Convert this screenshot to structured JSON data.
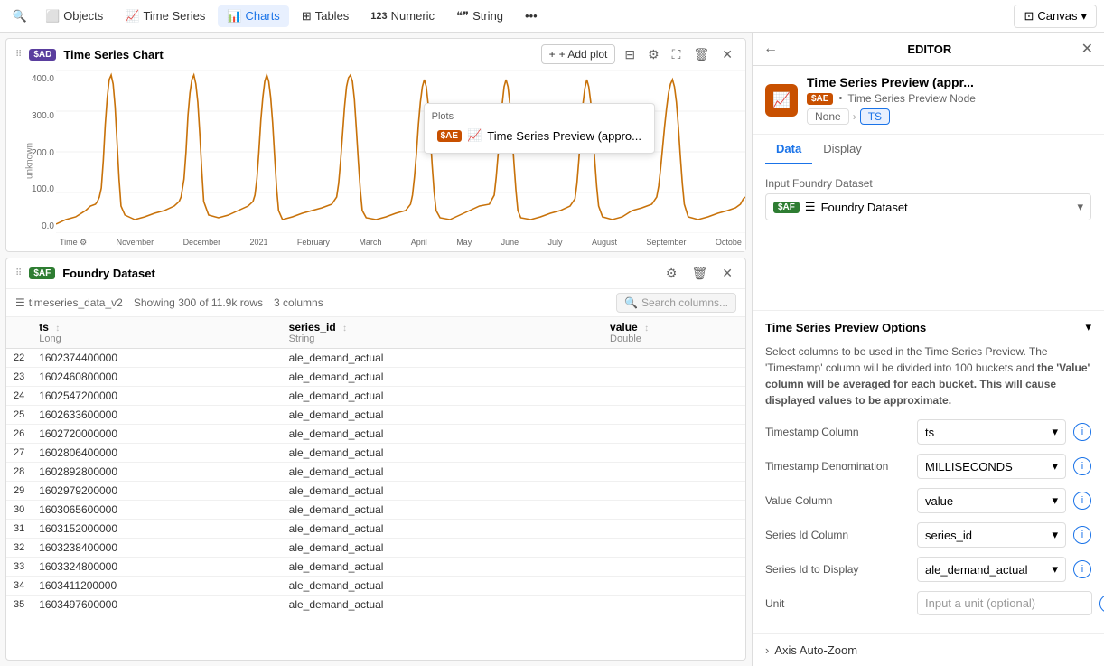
{
  "nav": {
    "search_icon": "🔍",
    "items": [
      {
        "id": "objects",
        "label": "Objects",
        "icon": "⬜"
      },
      {
        "id": "timeseries",
        "label": "Time Series",
        "icon": "📈"
      },
      {
        "id": "charts",
        "label": "Charts",
        "icon": "📊",
        "active": true
      },
      {
        "id": "tables",
        "label": "Tables",
        "icon": "⊞"
      },
      {
        "id": "numeric",
        "label": "Numeric",
        "icon": "123"
      },
      {
        "id": "string",
        "label": "String",
        "icon": "❝❞"
      },
      {
        "id": "more",
        "label": "...",
        "icon": ""
      },
      {
        "id": "canvas",
        "label": "Canvas",
        "icon": "⊡"
      }
    ]
  },
  "chart": {
    "drag_handle": "⠿",
    "node_badge": "$AD",
    "title": "Time Series Chart",
    "add_plot_label": "+ Add plot",
    "y_values": [
      "400.0",
      "300.0",
      "200.0",
      "100.0",
      "0.0"
    ],
    "y_label": "unknown",
    "x_labels": [
      "Time",
      "November",
      "December",
      "2021",
      "February",
      "March",
      "April",
      "May",
      "June",
      "July",
      "August",
      "September",
      "Octobe"
    ],
    "plots_label": "Plots",
    "plot_item": {
      "badge": "$AE",
      "label": "Time Series Preview (appro..."
    }
  },
  "table": {
    "drag_handle": "⠿",
    "node_badge": "$AF",
    "title": "Foundry Dataset",
    "table_icon": "☰",
    "table_name": "timeseries_data_v2",
    "showing_text": "Showing 300 of 11.9k rows",
    "columns_count": "3 columns",
    "search_placeholder": "Search columns...",
    "columns": [
      {
        "id": "ts",
        "label": "ts",
        "type": "Long"
      },
      {
        "id": "series_id",
        "label": "series_id",
        "type": "String"
      },
      {
        "id": "value",
        "label": "value",
        "type": "Double"
      }
    ],
    "rows": [
      {
        "num": "22",
        "ts": "1602374400000",
        "series_id": "ale_demand_actual",
        "value": ""
      },
      {
        "num": "23",
        "ts": "1602460800000",
        "series_id": "ale_demand_actual",
        "value": ""
      },
      {
        "num": "24",
        "ts": "1602547200000",
        "series_id": "ale_demand_actual",
        "value": ""
      },
      {
        "num": "25",
        "ts": "1602633600000",
        "series_id": "ale_demand_actual",
        "value": ""
      },
      {
        "num": "26",
        "ts": "1602720000000",
        "series_id": "ale_demand_actual",
        "value": ""
      },
      {
        "num": "27",
        "ts": "1602806400000",
        "series_id": "ale_demand_actual",
        "value": ""
      },
      {
        "num": "28",
        "ts": "1602892800000",
        "series_id": "ale_demand_actual",
        "value": ""
      },
      {
        "num": "29",
        "ts": "1602979200000",
        "series_id": "ale_demand_actual",
        "value": ""
      },
      {
        "num": "30",
        "ts": "1603065600000",
        "series_id": "ale_demand_actual",
        "value": ""
      },
      {
        "num": "31",
        "ts": "1603152000000",
        "series_id": "ale_demand_actual",
        "value": ""
      },
      {
        "num": "32",
        "ts": "1603238400000",
        "series_id": "ale_demand_actual",
        "value": ""
      },
      {
        "num": "33",
        "ts": "1603324800000",
        "series_id": "ale_demand_actual",
        "value": ""
      },
      {
        "num": "34",
        "ts": "1603411200000",
        "series_id": "ale_demand_actual",
        "value": ""
      },
      {
        "num": "35",
        "ts": "1603497600000",
        "series_id": "ale_demand_actual",
        "value": ""
      }
    ]
  },
  "editor": {
    "back_icon": "←",
    "title": "EDITOR",
    "close_icon": "✕",
    "node_icon": "📈",
    "node_name": "Time Series Preview (appr...",
    "node_badge": "$AE",
    "node_type": "Time Series Preview Node",
    "breadcrumb_none": "None",
    "breadcrumb_arrow": "›",
    "breadcrumb_ts": "TS",
    "tabs": [
      {
        "id": "data",
        "label": "Data",
        "active": true
      },
      {
        "id": "display",
        "label": "Display"
      }
    ],
    "input_dataset_label": "Input Foundry Dataset",
    "dataset_badge": "$AF",
    "dataset_name": "Foundry Dataset",
    "options_title": "Time Series Preview Options",
    "options_desc": "Select columns to be used in the Time Series Preview. The 'Timestamp' column will be divided into 100 buckets and the 'Value' column will be averaged for each bucket. This will cause displayed values to be approximate.",
    "fields": [
      {
        "id": "timestamp_column",
        "label": "Timestamp Column",
        "value": "ts"
      },
      {
        "id": "timestamp_denomination",
        "label": "Timestamp Denomination",
        "value": "MILLISECONDS"
      },
      {
        "id": "value_column",
        "label": "Value Column",
        "value": "value"
      },
      {
        "id": "series_id_column",
        "label": "Series Id Column",
        "value": "series_id"
      },
      {
        "id": "series_id_display",
        "label": "Series Id to Display",
        "value": "ale_demand_actual"
      },
      {
        "id": "unit",
        "label": "Unit",
        "value": "",
        "placeholder": "Input a unit (optional)"
      }
    ],
    "axis_zoom_label": "Axis Auto-Zoom"
  }
}
